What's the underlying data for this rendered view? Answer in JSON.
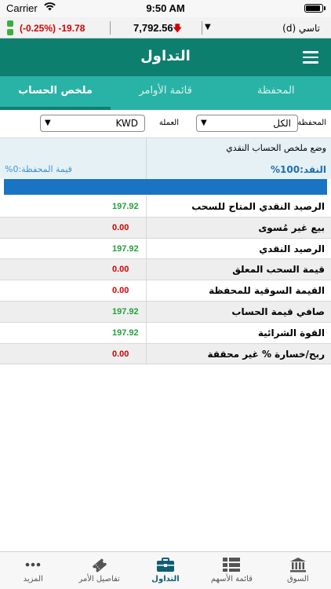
{
  "status_bar": {
    "carrier": "Carrier",
    "time": "9:50 AM",
    "battery_level": 0.95
  },
  "ticker": {
    "change": "(-0.25%)  -19.78",
    "index_value": "7,792.56",
    "direction": "down",
    "market": "تاسي (d)"
  },
  "header": {
    "title": "التداول"
  },
  "tabs": [
    {
      "label": "المحفظة",
      "active": false
    },
    {
      "label": "قائمة الأوامر",
      "active": false
    },
    {
      "label": "ملخص الحساب",
      "active": true
    }
  ],
  "filters": {
    "portfolio_label": "المحفظة",
    "portfolio_value": "الكل",
    "currency_label": "العملة",
    "currency_value": "KWD"
  },
  "summary": {
    "section_title": "وضع ملخص الحساب النقدي",
    "cash_label": "النقد:100%",
    "portfolio_value_label": "قيمة المحفظة:0%",
    "cash_ratio": 1.0,
    "rows": [
      {
        "label": "الرصيد النقدي المتاح للسحب",
        "value": "197.92",
        "kind": "pos"
      },
      {
        "label": "بيع غير مُسوى",
        "value": "0.00",
        "kind": "zero"
      },
      {
        "label": "الرصيد النقدي",
        "value": "197.92",
        "kind": "pos"
      },
      {
        "label": "قيمة السحب المعلق",
        "value": "0.00",
        "kind": "zero"
      },
      {
        "label": "القيمة السوقية للمحفظة",
        "value": "0.00",
        "kind": "zero"
      },
      {
        "label": "صافي قيمة الحساب",
        "value": "197.92",
        "kind": "pos"
      },
      {
        "label": "القوة الشرائية",
        "value": "197.92",
        "kind": "pos"
      },
      {
        "label": "ربح/خسارة % غير محققة",
        "value": "0.00",
        "kind": "zero"
      }
    ]
  },
  "tabbar": [
    {
      "label": "المزيد",
      "icon": "more-dots-icon",
      "active": false
    },
    {
      "label": "تفاصيل الأمر",
      "icon": "ticket-icon",
      "active": false
    },
    {
      "label": "التداول",
      "icon": "briefcase-icon",
      "active": true
    },
    {
      "label": "قائمة الأسهم",
      "icon": "list-icon",
      "active": false
    },
    {
      "label": "السوق",
      "icon": "bank-icon",
      "active": false
    }
  ],
  "colors": {
    "header": "#0d7f6f",
    "tabs": "#29b3a6",
    "positive": "#23a03c",
    "negative": "#d40000",
    "bar": "#1a74c4"
  }
}
